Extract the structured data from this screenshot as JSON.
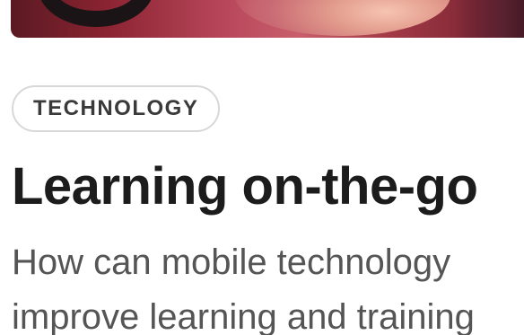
{
  "card": {
    "category_tag": "TECHNOLOGY",
    "title": "Learning on-the-go",
    "description_line1": "How can mobile technology",
    "description_line2": "improve learning and training"
  },
  "colors": {
    "title_text": "#1c1c1c",
    "description_text": "#555555",
    "tag_border": "#d8d8d8",
    "tag_text": "#3a3a3a"
  }
}
